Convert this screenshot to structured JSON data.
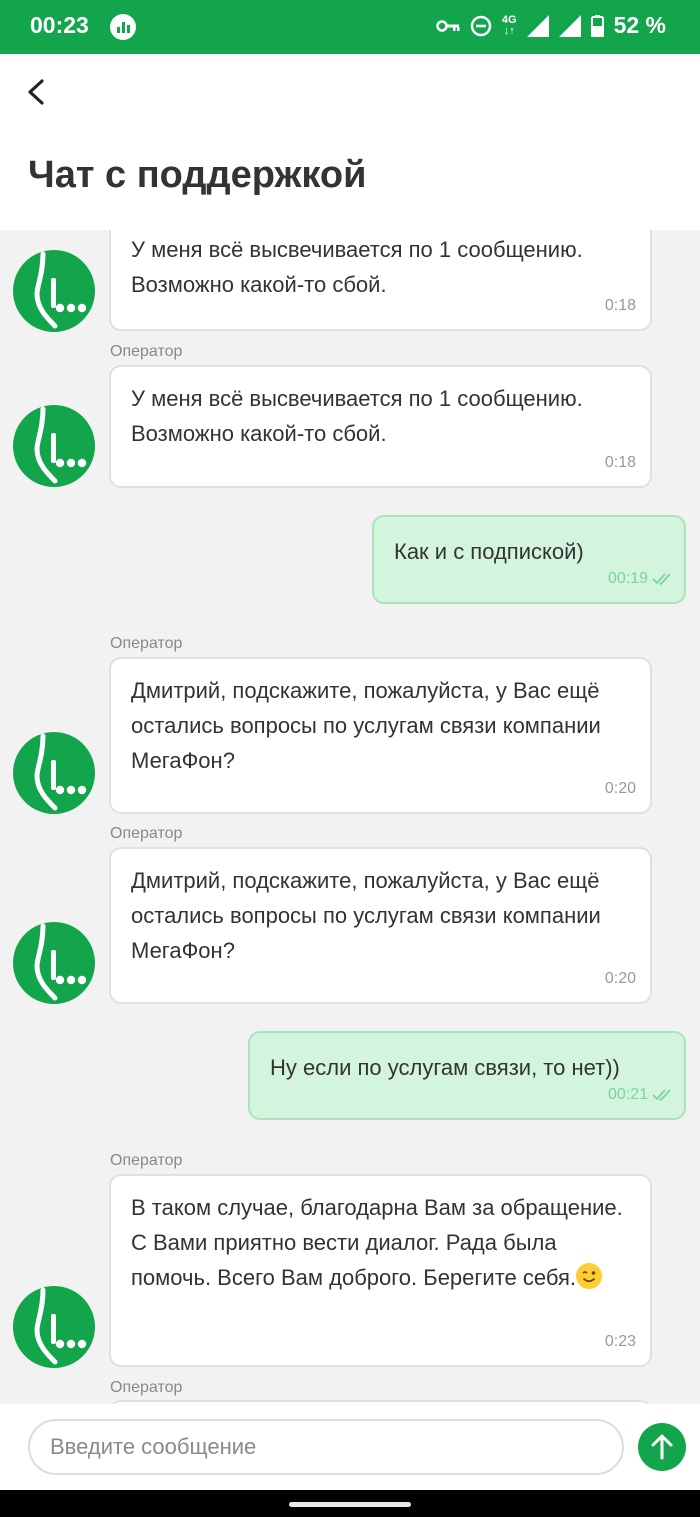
{
  "status_bar": {
    "time": "00:23",
    "network": "4G",
    "battery": "52 %",
    "background_color": "#13a54b"
  },
  "header": {
    "back_icon": "chevron-left-icon",
    "title": "Чат с поддержкой"
  },
  "messages": [
    {
      "side": "in",
      "label": "",
      "text": "У меня всё высвечивается по 1 сообщению. Возможно какой-то сбой.",
      "time": "0:18"
    },
    {
      "side": "in",
      "label": "Оператор",
      "text": "У меня всё высвечивается по 1 сообщению. Возможно какой-то сбой.",
      "time": "0:18"
    },
    {
      "side": "out",
      "text": "Как и с подпиской)",
      "time": "00:19",
      "status_icon": "double-check-icon"
    },
    {
      "side": "in",
      "label": "Оператор",
      "text": "Дмитрий, подскажите, пожалуйста, у Вас ещё остались вопросы по услугам связи компании МегаФон?",
      "time": "0:20"
    },
    {
      "side": "in",
      "label": "Оператор",
      "text": "Дмитрий, подскажите, пожалуйста, у Вас ещё остались вопросы по услугам связи компании МегаФон?",
      "time": "0:20"
    },
    {
      "side": "out",
      "text": "Ну если по услугам связи, то нет))",
      "time": "00:21",
      "status_icon": "double-check-icon"
    },
    {
      "side": "in",
      "label": "Оператор",
      "text": "В таком случае, благодарна Вам за обращение. С Вами приятно вести диалог. Рада была помочь. Всего Вам доброго. Берегите себя.",
      "emoji": "wink-emoji-icon",
      "time": "0:23"
    },
    {
      "side": "in",
      "label": "Оператор",
      "text": "",
      "time": ""
    }
  ],
  "composer": {
    "placeholder": "Введите сообщение",
    "value": "",
    "send_icon": "arrow-up-icon"
  },
  "colors": {
    "brand_green": "#13a54b",
    "outgoing_bubble": "#d3f5dd",
    "incoming_bubble": "#ffffff"
  }
}
